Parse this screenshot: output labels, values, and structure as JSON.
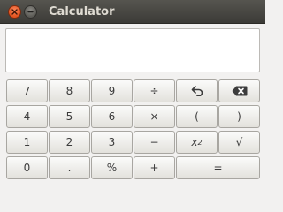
{
  "window": {
    "title": "Calculator",
    "close_icon": "close-icon",
    "minimize_icon": "minimize-icon"
  },
  "display": {
    "value": ""
  },
  "keys": {
    "seven": "7",
    "eight": "8",
    "nine": "9",
    "divide": "÷",
    "undo_icon": "undo-icon",
    "backspace_icon": "backspace-icon",
    "four": "4",
    "five": "5",
    "six": "6",
    "multiply": "×",
    "open_paren": "(",
    "close_paren": ")",
    "one": "1",
    "two": "2",
    "three": "3",
    "subtract": "−",
    "square_base": "x",
    "square_exp": "2",
    "sqrt": "√",
    "zero": "0",
    "decimal": ".",
    "percent": "%",
    "add": "+",
    "equals": "="
  },
  "colors": {
    "titlebar": "#3c3b37",
    "title_text": "#dfdbd2",
    "close": "#e2531f",
    "background": "#f2f1f0"
  }
}
